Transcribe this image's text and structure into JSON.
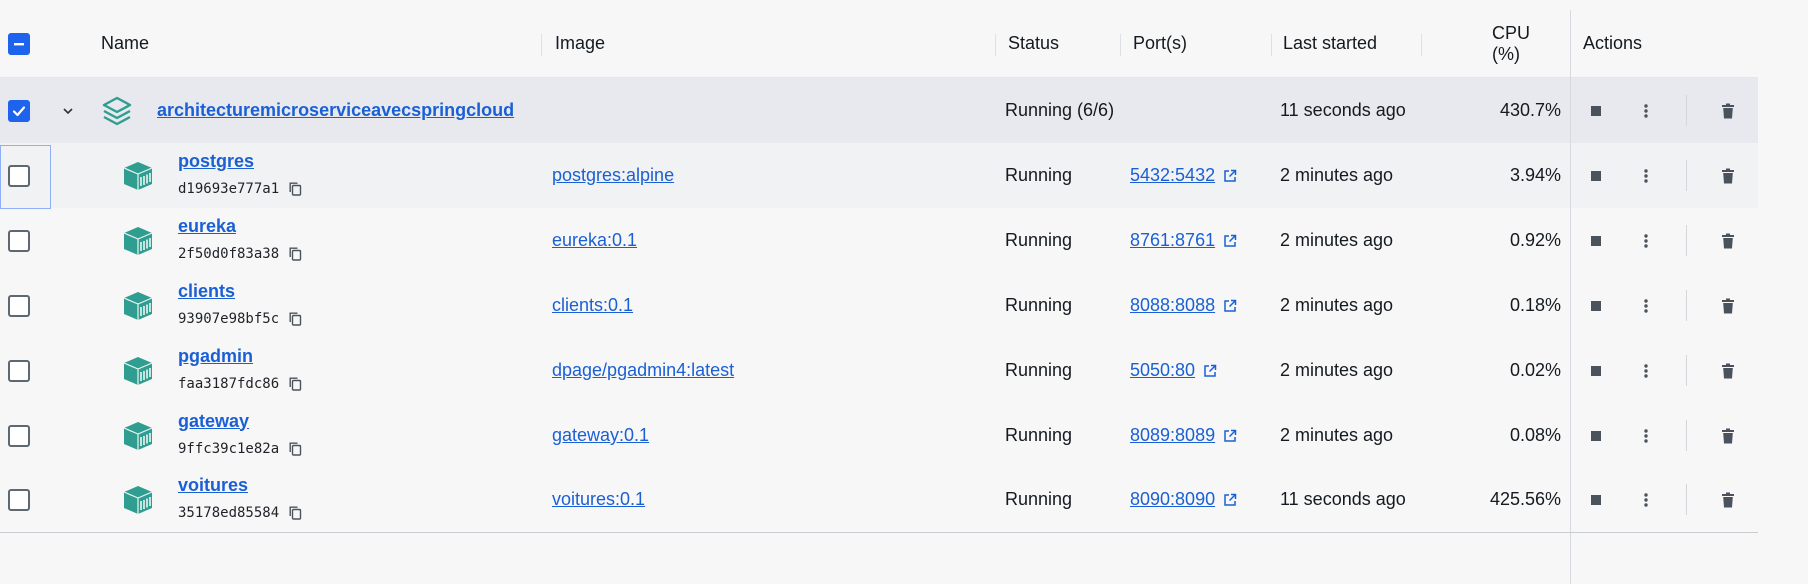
{
  "columns": {
    "name": "Name",
    "image": "Image",
    "status": "Status",
    "ports": "Port(s)",
    "last_started": "Last started",
    "cpu": "CPU (%)",
    "actions": "Actions"
  },
  "group": {
    "name": "architecturemicroserviceavecspringcloud",
    "status": "Running (6/6)",
    "last_started": "11 seconds ago",
    "cpu": "430.7%",
    "selected": true
  },
  "containers": [
    {
      "name": "postgres",
      "id": "d19693e777a1",
      "image": "postgres:alpine",
      "status": "Running",
      "ports": "5432:5432",
      "last_started": "2 minutes ago",
      "cpu": "3.94%"
    },
    {
      "name": "eureka",
      "id": "2f50d0f83a38",
      "image": "eureka:0.1",
      "status": "Running",
      "ports": "8761:8761",
      "last_started": "2 minutes ago",
      "cpu": "0.92%"
    },
    {
      "name": "clients",
      "id": "93907e98bf5c",
      "image": "clients:0.1",
      "status": "Running",
      "ports": "8088:8088",
      "last_started": "2 minutes ago",
      "cpu": "0.18%"
    },
    {
      "name": "pgadmin",
      "id": "faa3187fdc86",
      "image": "dpage/pgadmin4:latest",
      "status": "Running",
      "ports": "5050:80",
      "last_started": "2 minutes ago",
      "cpu": "0.02%"
    },
    {
      "name": "gateway",
      "id": "9ffc39c1e82a",
      "image": "gateway:0.1",
      "status": "Running",
      "ports": "8089:8089",
      "last_started": "2 minutes ago",
      "cpu": "0.08%"
    },
    {
      "name": "voitures",
      "id": "35178ed85584",
      "image": "voitures:0.1",
      "status": "Running",
      "ports": "8090:8090",
      "last_started": "11 seconds ago",
      "cpu": "425.56%"
    }
  ],
  "icons": {
    "header_checkbox": "indeterminate-checkbox-icon",
    "group_icon": "stack-layers-icon",
    "container_icon": "container-cube-icon",
    "copy": "copy-icon",
    "external": "external-link-icon",
    "stop": "stop-icon",
    "more": "more-vertical-icon",
    "delete": "trash-icon",
    "expand": "chevron-down-icon"
  },
  "colors": {
    "accent": "#1d63ed",
    "link": "#1a60d4",
    "container_icon": "#2f9d8f",
    "group_row_bg": "#e7e9ee"
  }
}
